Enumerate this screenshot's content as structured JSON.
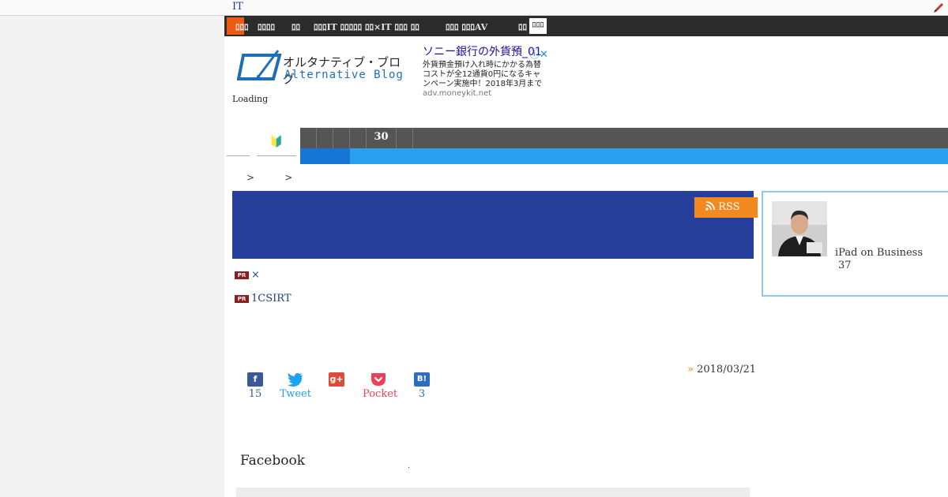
{
  "topbar": {
    "link_text": "IT"
  },
  "dark_nav": {
    "items": [
      "ﾛﾛﾛ",
      "ﾛﾛﾛﾛ",
      "ﾛﾛ",
      "ﾛﾛﾛIT ﾛﾛﾛﾛﾛ",
      "ﾛﾛ×IT ﾛﾛﾛ ﾛﾛ",
      "ﾛﾛﾛ ﾛﾛﾛAV",
      "ﾛﾛ"
    ],
    "white_item": "ﾛﾛﾛ"
  },
  "header": {
    "logo_jp": "オルタナティブ・ブログ",
    "logo_en": "Alternative Blog",
    "loading": "Loading"
  },
  "ad": {
    "title": "ソニー銀行の外貨預_01",
    "body": "外貨預金預け入れ時にかかる為替コストが全12通貨0円になるキャンペーン実施中！2018年3月まで",
    "domain": "adv.moneykit.net",
    "close": "ⓘ✕"
  },
  "nav": {
    "beginner_icon": "🔰",
    "gray_items": [
      "",
      "",
      "",
      "",
      "30",
      ""
    ]
  },
  "breadcrumb": {
    "text": ">          >"
  },
  "banner": {
    "rss_label": "RSS"
  },
  "pr_items": [
    {
      "badge": "PR",
      "text": "×"
    },
    {
      "badge": "PR",
      "text": "1CSIRT"
    }
  ],
  "share": {
    "facebook": {
      "icon": "f",
      "label": "15",
      "color": "#3b5998"
    },
    "twitter": {
      "icon": "t",
      "label": "Tweet",
      "color": "#1da1f2"
    },
    "googleplus": {
      "icon": "g+",
      "label": "",
      "color": "#dd4b39"
    },
    "pocket": {
      "icon": "p",
      "label": "Pocket",
      "color": "#ee4056"
    },
    "hatena": {
      "icon": "B!",
      "label": "3",
      "color": "#2c6ebd"
    }
  },
  "post": {
    "date_mark": "»",
    "date": "2018/03/21"
  },
  "facebook_section": {
    "heading": "Facebook",
    "dot": "."
  },
  "sidebar": {
    "author_name": "iPad on Business",
    "author_count": "37"
  }
}
